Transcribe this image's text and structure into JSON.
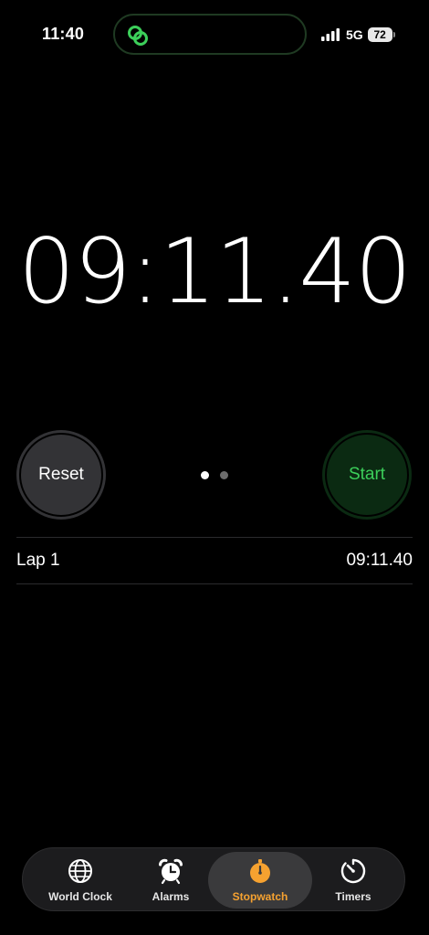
{
  "status_bar": {
    "time": "11:40",
    "network": "5G",
    "battery": "72"
  },
  "stopwatch": {
    "time": "09:11.40"
  },
  "controls": {
    "reset_label": "Reset",
    "start_label": "Start",
    "pages": 2,
    "current_page": 1
  },
  "laps": [
    {
      "label": "Lap 1",
      "time": "09:11.40"
    }
  ],
  "tabs": [
    {
      "label": "World Clock",
      "icon": "globe-icon",
      "active": false
    },
    {
      "label": "Alarms",
      "icon": "alarm-clock-icon",
      "active": false
    },
    {
      "label": "Stopwatch",
      "icon": "stopwatch-icon",
      "active": true
    },
    {
      "label": "Timers",
      "icon": "timer-icon",
      "active": false
    }
  ],
  "colors": {
    "accent": "#f6a230",
    "start_green": "#3ccf5a",
    "island_icon": "#3ccf5a"
  }
}
